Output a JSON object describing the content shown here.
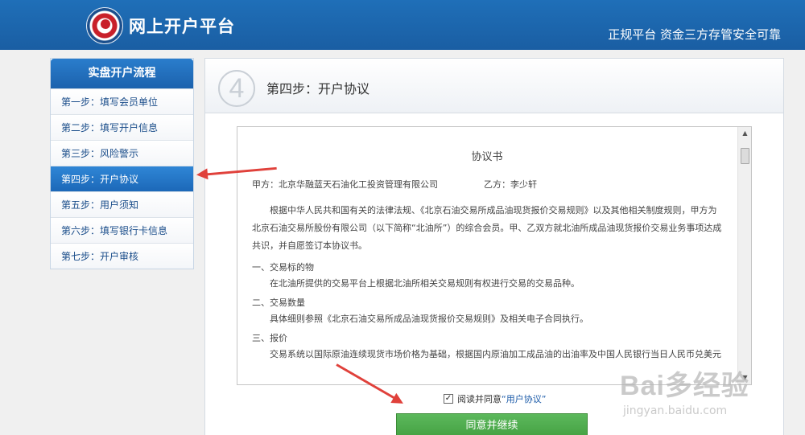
{
  "header": {
    "site_title": "网上开户平台",
    "slogan": "正规平台 资金三方存管安全可靠"
  },
  "sidebar": {
    "title": "实盘开户流程",
    "items": [
      {
        "label": "第一步：填写会员单位"
      },
      {
        "label": "第二步：填写开户信息"
      },
      {
        "label": "第三步：风险警示"
      },
      {
        "label": "第四步：开户协议"
      },
      {
        "label": "第五步：用户须知"
      },
      {
        "label": "第六步：填写银行卡信息"
      },
      {
        "label": "第七步：开户审核"
      }
    ],
    "active_index": 3
  },
  "main": {
    "step_number": "4",
    "step_title": "第四步：开户协议"
  },
  "agreement": {
    "title": "协议书",
    "party_a": "甲方：北京华融蓝天石油化工投资管理有限公司",
    "party_b": "乙方：李少轩",
    "intro": "根据中华人民共和国有关的法律法规、《北京石油交易所成品油现货报价交易规则》以及其他相关制度规则，甲方为北京石油交易所股份有限公司（以下简称“北油所”）的综合会员。甲、乙双方就北油所成品油现货报价交易业务事项达成共识，并自愿签订本协议书。",
    "sections": [
      {
        "heading": "一、交易标的物",
        "body": "在北油所提供的交易平台上根据北油所相关交易规则有权进行交易的交易品种。"
      },
      {
        "heading": "二、交易数量",
        "body": "具体细则参照《北京石油交易所成品油现货报价交易规则》及相关电子合同执行。"
      },
      {
        "heading": "三、报价",
        "body": "交易系统以国际原油连续现货市场价格为基础，根据国内原油加工成品油的出油率及中国人民银行当日人民币兑美元"
      }
    ]
  },
  "agree_check": {
    "checked": true,
    "check_mark": "✓",
    "prefix": "阅读并同意",
    "link": "“用户协议”"
  },
  "continue_button": "同意并继续",
  "watermark": {
    "main": "Bai多经验",
    "sub": "jingyan.baidu.com"
  }
}
